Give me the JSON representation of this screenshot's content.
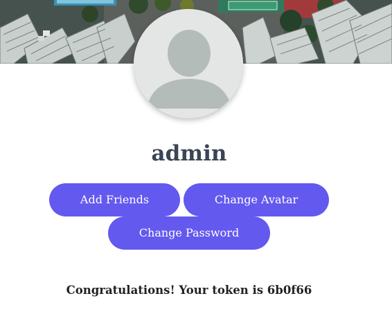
{
  "profile": {
    "username": "admin"
  },
  "actions": {
    "add_friends": "Add Friends",
    "change_avatar": "Change Avatar",
    "change_password": "Change Password"
  },
  "message": {
    "text": "Congratulations! Your token is 6b0f66"
  },
  "colors": {
    "button_bg": "#6359ef",
    "username_text": "#3a4555"
  }
}
